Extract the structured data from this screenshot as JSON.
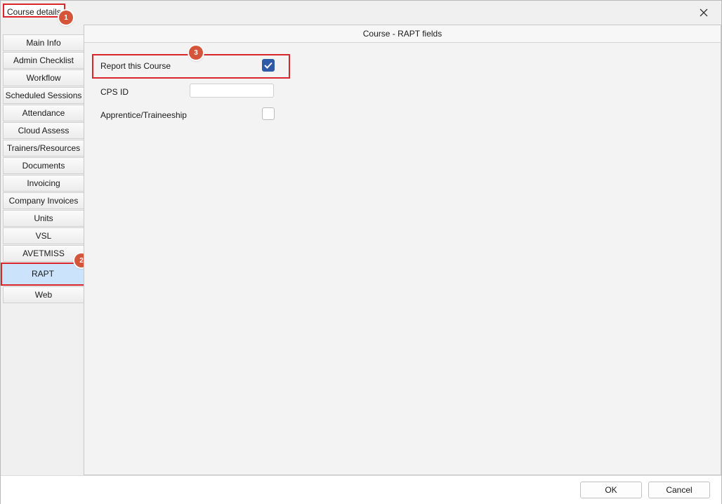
{
  "window": {
    "title": "Course details"
  },
  "annotations": [
    "1",
    "2",
    "3"
  ],
  "sidebar": {
    "tabs": [
      {
        "label": "Main Info"
      },
      {
        "label": "Admin Checklist"
      },
      {
        "label": "Workflow"
      },
      {
        "label": "Scheduled Sessions"
      },
      {
        "label": "Attendance"
      },
      {
        "label": "Cloud Assess"
      },
      {
        "label": "Trainers/Resources"
      },
      {
        "label": "Documents"
      },
      {
        "label": "Invoicing"
      },
      {
        "label": "Company Invoices"
      },
      {
        "label": "Units"
      },
      {
        "label": "VSL"
      },
      {
        "label": "AVETMISS"
      },
      {
        "label": "RAPT"
      },
      {
        "label": "Web"
      }
    ],
    "active_tab": "RAPT"
  },
  "panel": {
    "header": "Course - RAPT fields",
    "fields": {
      "report_label": "Report this Course",
      "report_checked": true,
      "cps_label": "CPS ID",
      "cps_value": "",
      "apprentice_label": "Apprentice/Traineeship",
      "apprentice_checked": false
    }
  },
  "footer": {
    "ok_label": "OK",
    "cancel_label": "Cancel"
  },
  "colors": {
    "highlight": "#d9262b",
    "badge": "#d4553a",
    "active_tab": "#cce4fb",
    "checkbox_checked": "#2f5aa8"
  },
  "icons": {
    "close": "close-icon",
    "check": "checkmark-icon"
  }
}
